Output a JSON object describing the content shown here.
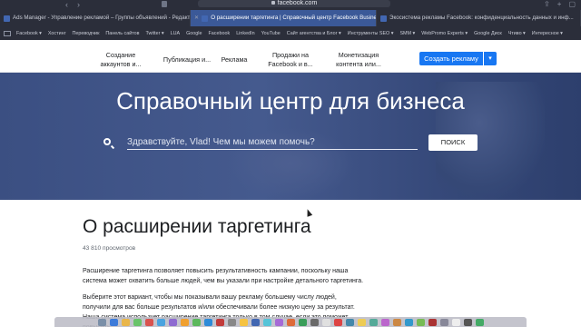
{
  "browser": {
    "address": "facebook.com",
    "tabs": [
      {
        "label": "Ads Manager - Управление рекламой – Группы объявлений - Редакти...",
        "active": false
      },
      {
        "label": "О расширении таргетинга | Справочный центр Facebook Business",
        "active": true
      },
      {
        "label": "Экосистема рекламы Facebook: конфиденциальность данных и инф...",
        "active": false
      }
    ],
    "bookmarks": [
      "Facebook ▾",
      "Хостинг",
      "Переводчик",
      "Панель сайтов",
      "Twitter ▾",
      "LUA",
      "Google",
      "Facebook",
      "LinkedIn",
      "YouTube",
      "Сайт агентства и Блог ▾",
      "Инструменты SEO ▾",
      "SMM ▾",
      "WebPromo Experts ▾",
      "Google Диск",
      "Чтиво ▾",
      "Интересное ▾"
    ]
  },
  "nav": {
    "items": [
      "Создание аккаунтов и...",
      "Публикация и...",
      "Реклама",
      "Продажи на Facebook и в...",
      "Монетизация контента или..."
    ],
    "cta_label": "Создать рекламу",
    "cta_dropdown": "▾"
  },
  "hero": {
    "title": "Справочный центр для бизнеса",
    "search_placeholder": "Здравствуйте, Vlad! Чем мы можем помочь?",
    "search_button": "ПОИСК"
  },
  "article": {
    "title": "О расширении таргетинга",
    "views": "43 810 просмотров",
    "paragraph1": "Расширение таргетинга позволяет повысить результативность кампании, поскольку наша система может охватить больше людей, чем вы указали при настройке детального таргетинга.",
    "paragraph2": "Выберите этот вариант, чтобы мы показывали вашу рекламу большему числу людей, получили для вас больше результатов и/или обеспечивали более низкую цену за результат. Наша система использует расширение таргетинга только в том случае, если это поможет повысить"
  },
  "colors": {
    "chrome_bg": "#2b2e3a",
    "hero_bg": "#3b4f82",
    "cta": "#1877f2"
  },
  "dock_colors": [
    "#7a8fa8",
    "#3d7bd9",
    "#e9b64a",
    "#6ac46b",
    "#d9534f",
    "#4aa3df",
    "#8e6bd1",
    "#f0a030",
    "#5cb85c",
    "#2e8bd8",
    "#c23b3b",
    "#888",
    "#f6c342",
    "#4267b2",
    "#56c4d8",
    "#a66bd6",
    "#de6b3a",
    "#3a9e5a",
    "#6a6a6a",
    "#e0e0e0",
    "#d44",
    "#48a",
    "#ec5",
    "#5a9",
    "#b6c",
    "#c84",
    "#39c",
    "#7b5",
    "#a33",
    "#889",
    "#eee",
    "#555",
    "#4a6"
  ]
}
